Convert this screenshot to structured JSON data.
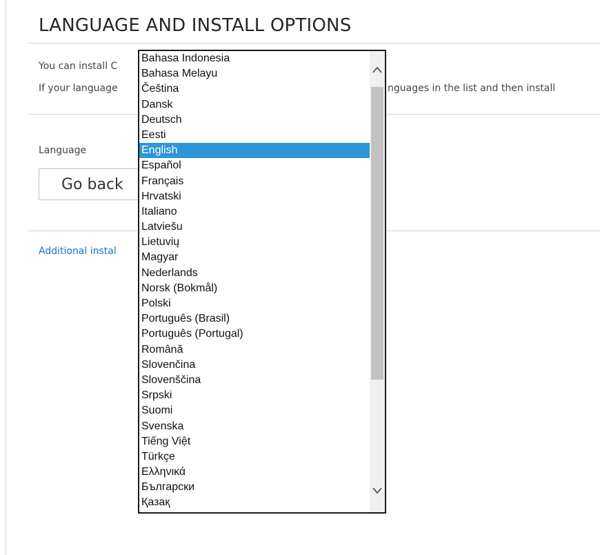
{
  "page": {
    "title": "LANGUAGE AND INSTALL OPTIONS",
    "desc_line1": "You can install C",
    "desc_line2_left": "If your language",
    "desc_line2_right": "nguages in the list and then install",
    "language_label": "Language",
    "go_back_label": "Go back",
    "additional_link": "Additional instal"
  },
  "dropdown": {
    "selected": "English",
    "options": [
      "Bahasa Indonesia",
      "Bahasa Melayu",
      "Čeština",
      "Dansk",
      "Deutsch",
      "Eesti",
      "English",
      "Español",
      "Français",
      "Hrvatski",
      "Italiano",
      "Latviešu",
      "Lietuvių",
      "Magyar",
      "Nederlands",
      "Norsk (Bokmål)",
      "Polski",
      "Português (Brasil)",
      "Português (Portugal)",
      "Română",
      "Slovenčina",
      "Slovenščina",
      "Srpski",
      "Suomi",
      "Svenska",
      "Tiếng Việt",
      "Türkçe",
      "Ελληνικά",
      "Български",
      "Қазақ"
    ],
    "scroll_up_icon": "chevron-up-icon",
    "scroll_down_icon": "chevron-down-icon"
  },
  "colors": {
    "selected_bg": "#2e96d4",
    "link": "#1a73c7"
  }
}
